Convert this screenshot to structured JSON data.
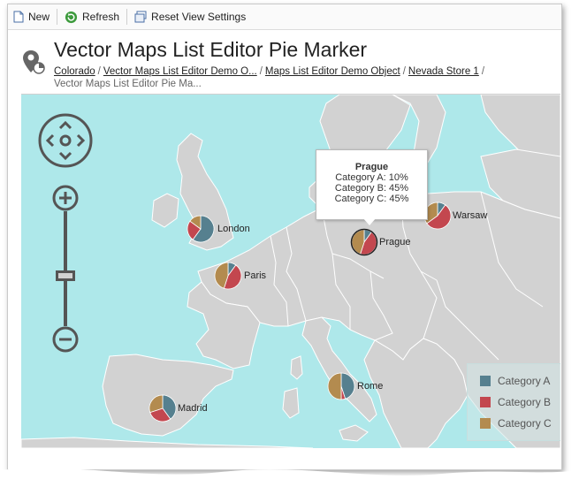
{
  "toolbar": {
    "new_label": "New",
    "refresh_label": "Refresh",
    "reset_label": "Reset View Settings"
  },
  "header": {
    "title": "Vector Maps List Editor Pie Marker",
    "breadcrumbs": [
      "Colorado",
      "Vector Maps List Editor Demo O...",
      "Maps List Editor Demo Object",
      "Nevada Store 1",
      "Vector Maps List Editor Pie Ma..."
    ]
  },
  "map": {
    "cities": [
      {
        "name": "London",
        "values": [
          0.6,
          0.25,
          0.15
        ]
      },
      {
        "name": "Paris",
        "values": [
          0.1,
          0.45,
          0.45
        ]
      },
      {
        "name": "Prague",
        "values": [
          0.1,
          0.45,
          0.45
        ]
      },
      {
        "name": "Warsaw",
        "values": [
          0.1,
          0.55,
          0.35
        ]
      },
      {
        "name": "Madrid",
        "values": [
          0.4,
          0.3,
          0.3
        ]
      },
      {
        "name": "Rome",
        "values": [
          0.45,
          0.05,
          0.5
        ]
      }
    ],
    "tooltip": {
      "city": "Prague",
      "lines": [
        "Category A: 10%",
        "Category B: 45%",
        "Category C: 45%"
      ]
    },
    "legend": {
      "items": [
        {
          "label": "Category A",
          "color": "#56808f"
        },
        {
          "label": "Category B",
          "color": "#c3474f"
        },
        {
          "label": "Category C",
          "color": "#b38b4f"
        }
      ]
    },
    "colors": {
      "water": "#aee8ea",
      "land": "#d2d2d2",
      "border": "#ffffff"
    }
  }
}
